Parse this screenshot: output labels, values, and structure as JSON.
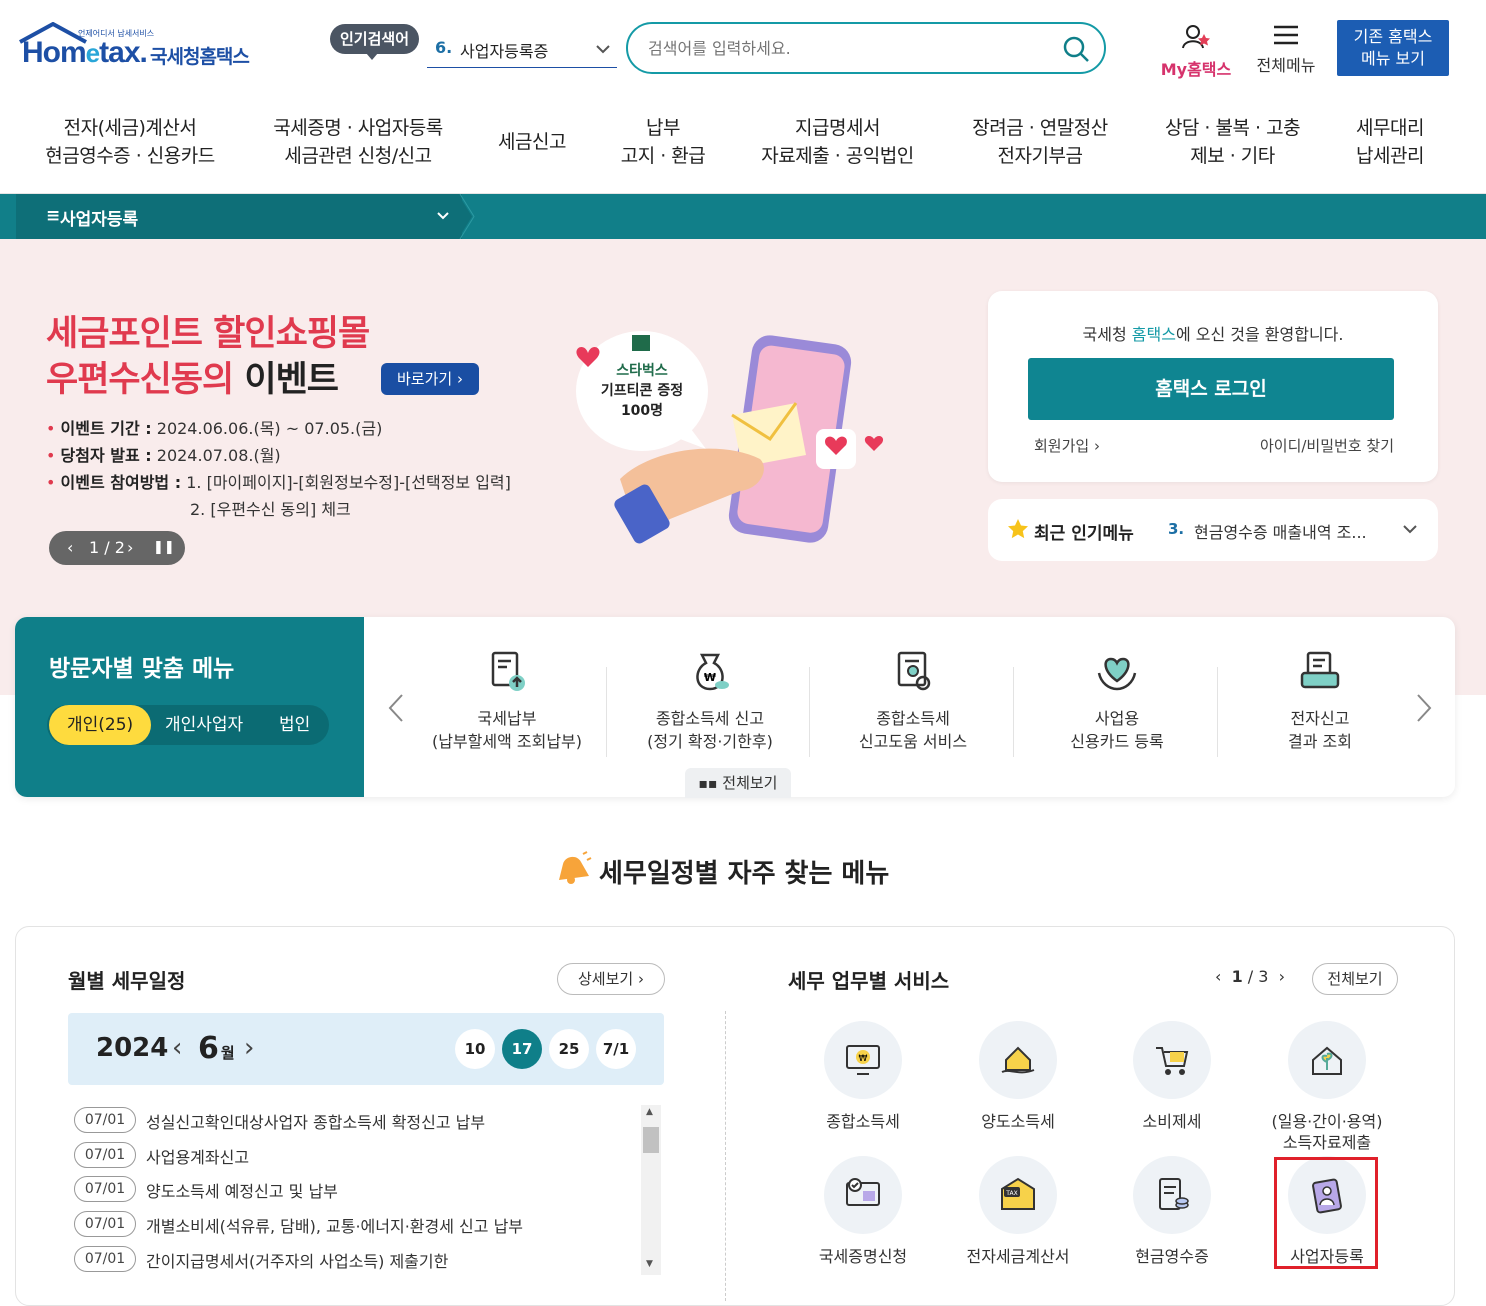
{
  "header": {
    "logo_text_a": "Hom",
    "logo_text_e": "e",
    "logo_text_b": "tax.",
    "logo_sub": "국세청홈택스",
    "logo_tag": "언제어디서 납세서비스",
    "popular_badge": "인기검색어",
    "popular_num": "6.",
    "popular_text": "사업자등록증",
    "search_placeholder": "검색어를 입력하세요.",
    "myhome_label": "My홈택스",
    "allmenu_label": "전체메뉴",
    "old_menu_line1": "기존 홈택스",
    "old_menu_line2": "메뉴 보기"
  },
  "gnb": [
    {
      "l1": "전자(세금)계산서",
      "l2": "현금영수증 · 신용카드"
    },
    {
      "l1": "국세증명 · 사업자등록",
      "l2": "세금관련 신청/신고"
    },
    {
      "l1": "세금신고",
      "l2": ""
    },
    {
      "l1": "납부",
      "l2": "고지 · 환급"
    },
    {
      "l1": "지급명세서",
      "l2": "자료제출 · 공익법인"
    },
    {
      "l1": "장려금 · 연말정산",
      "l2": "전자기부금"
    },
    {
      "l1": "상담 · 불복 · 고충",
      "l2": "제보 · 기타"
    },
    {
      "l1": "세무대리",
      "l2": "납세관리"
    }
  ],
  "breadcrumb": {
    "title": "사업자등록"
  },
  "event": {
    "title_line1": "세금포인트 할인쇼핑몰",
    "title_line2_red": "우편수신동의 ",
    "title_line2_black": "이벤트",
    "go_label": "바로가기",
    "period_label": "이벤트 기간 :",
    "period_value": "2024.06.06.(목) ~ 07.05.(금)",
    "announce_label": "당첨자 발표 :",
    "announce_value": "2024.07.08.(월)",
    "method_label": "이벤트 참여방법 :",
    "method_1": "1. [마이페이지]-[회원정보수정]-[선택정보 입력]",
    "method_2": "2. [우편수신 동의] 체크",
    "bubble_1": "스타벅스",
    "bubble_2": "기프티콘 증정",
    "bubble_3": "100명",
    "pager": "1 / 2"
  },
  "login": {
    "welcome_a": "국세청 ",
    "welcome_b": "홈택스",
    "welcome_c": "에 오신 것을 환영합니다.",
    "button": "홈택스 로그인",
    "join": "회원가입",
    "find": "아이디/비밀번호 찾기"
  },
  "popular_menu": {
    "label": "최근 인기메뉴",
    "num": "3.",
    "text": "현금영수증 매출내역 조..."
  },
  "visitor": {
    "heading": "방문자별 맞춤 메뉴",
    "tabs": [
      "개인(25)",
      "개인사업자",
      "법인"
    ],
    "items": [
      {
        "l1": "국세납부",
        "l2": "(납부할세액 조회납부)"
      },
      {
        "l1": "종합소득세 신고",
        "l2": "(정기 확정·기한후)"
      },
      {
        "l1": "종합소득세",
        "l2": "신고도움 서비스"
      },
      {
        "l1": "사업용",
        "l2": "신용카드 등록"
      },
      {
        "l1": "전자신고",
        "l2": "결과 조회"
      }
    ],
    "all_view": "전체보기"
  },
  "section_title": "세무일정별 자주 찾는 메뉴",
  "schedule": {
    "heading": "월별 세무일정",
    "detail": "상세보기",
    "year": "2024",
    "month": "6",
    "month_unit": "월",
    "days": [
      "10",
      "17",
      "25",
      "7/1"
    ],
    "selected_day": "17",
    "items": [
      {
        "date": "07/01",
        "text": "성실신고확인대상사업자 종합소득세 확정신고 납부"
      },
      {
        "date": "07/01",
        "text": "사업용계좌신고"
      },
      {
        "date": "07/01",
        "text": "양도소득세 예정신고 및 납부"
      },
      {
        "date": "07/01",
        "text": "개별소비세(석유류, 담배), 교통·에너지·환경세 신고 납부"
      },
      {
        "date": "07/01",
        "text": "간이지급명세서(거주자의 사업소득) 제출기한"
      }
    ]
  },
  "services": {
    "heading": "세무 업무별 서비스",
    "page_current": "1",
    "page_total": "3",
    "all_view": "전체보기",
    "items": [
      {
        "l1": "종합소득세",
        "l2": ""
      },
      {
        "l1": "양도소득세",
        "l2": ""
      },
      {
        "l1": "소비제세",
        "l2": ""
      },
      {
        "l1": "(일용·간이·용역)",
        "l2": "소득자료제출"
      },
      {
        "l1": "국세증명신청",
        "l2": ""
      },
      {
        "l1": "전자세금계산서",
        "l2": ""
      },
      {
        "l1": "현금영수증",
        "l2": ""
      },
      {
        "l1": "사업자등록",
        "l2": ""
      }
    ]
  },
  "colors": {
    "teal": "#0f7f89",
    "brand_blue": "#1d4fa5",
    "accent_red": "#e03a4e",
    "highlight_red": "#e0202a",
    "yellow": "#fedb3e"
  }
}
